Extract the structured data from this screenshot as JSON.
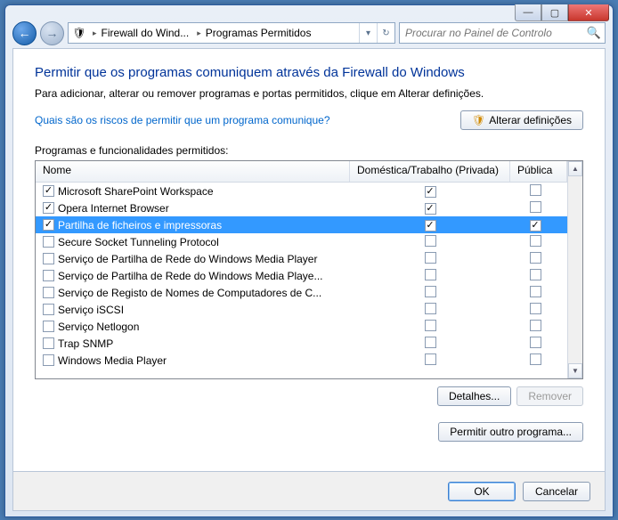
{
  "breadcrumb": {
    "seg1": "Firewall do Wind...",
    "seg2": "Programas Permitidos"
  },
  "search": {
    "placeholder": "Procurar no Painel de Controlo"
  },
  "heading": "Permitir que os programas comuniquem através da Firewall do Windows",
  "subheading": "Para adicionar, alterar ou remover programas e portas permitidos, clique em Alterar definições.",
  "risk_link": "Quais são os riscos de permitir que um programa comunique?",
  "change_btn": "Alterar definições",
  "group_label": "Programas e funcionalidades permitidos:",
  "cols": {
    "name": "Nome",
    "priv": "Doméstica/Trabalho (Privada)",
    "pub": "Pública"
  },
  "rows": [
    {
      "name": "Microsoft SharePoint Workspace",
      "c1": true,
      "c2": true,
      "c3": false,
      "sel": false
    },
    {
      "name": "Opera Internet Browser",
      "c1": true,
      "c2": true,
      "c3": false,
      "sel": false
    },
    {
      "name": "Partilha de ficheiros e impressoras",
      "c1": true,
      "c2": true,
      "c3": true,
      "sel": true
    },
    {
      "name": "Secure Socket Tunneling Protocol",
      "c1": false,
      "c2": false,
      "c3": false,
      "sel": false
    },
    {
      "name": "Serviço de Partilha de Rede do Windows Media Player",
      "c1": false,
      "c2": false,
      "c3": false,
      "sel": false
    },
    {
      "name": "Serviço de Partilha de Rede do Windows Media Playe...",
      "c1": false,
      "c2": false,
      "c3": false,
      "sel": false
    },
    {
      "name": "Serviço de Registo de Nomes de Computadores de C...",
      "c1": false,
      "c2": false,
      "c3": false,
      "sel": false
    },
    {
      "name": "Serviço iSCSI",
      "c1": false,
      "c2": false,
      "c3": false,
      "sel": false
    },
    {
      "name": "Serviço Netlogon",
      "c1": false,
      "c2": false,
      "c3": false,
      "sel": false
    },
    {
      "name": "Trap SNMP",
      "c1": false,
      "c2": false,
      "c3": false,
      "sel": false
    },
    {
      "name": "Windows Media Player",
      "c1": false,
      "c2": false,
      "c3": false,
      "sel": false
    }
  ],
  "details_btn": "Detalhes...",
  "remove_btn": "Remover",
  "allow_other_btn": "Permitir outro programa...",
  "ok_btn": "OK",
  "cancel_btn": "Cancelar"
}
